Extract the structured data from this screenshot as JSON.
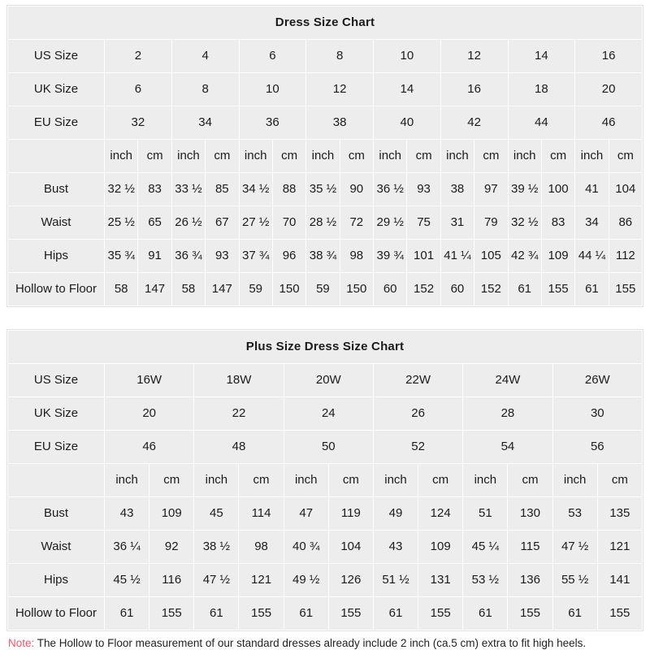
{
  "note": {
    "tag": "Note:",
    "text": " The Hollow to Floor measurement of our standard dresses already include 2 inch (ca.5 cm) extra to fit high heels."
  },
  "units": {
    "inch": "inch",
    "cm": "cm"
  },
  "labels": {
    "us_size": "US Size",
    "uk_size": "UK Size",
    "eu_size": "EU Size",
    "bust": "Bust",
    "waist": "Waist",
    "hips": "Hips",
    "hollow_to_floor": "Hollow to Floor"
  },
  "colors": {
    "cell_gray": "#ededed",
    "cell_white": "#ffffff",
    "grid_line": "#ffffff",
    "text": "#1b1b1b",
    "note_accent": "#f0566e"
  },
  "standard_chart": {
    "title": "Dress Size Chart",
    "size_count": 8,
    "us_sizes": [
      "2",
      "4",
      "6",
      "8",
      "10",
      "12",
      "14",
      "16"
    ],
    "uk_sizes": [
      "6",
      "8",
      "10",
      "12",
      "14",
      "16",
      "18",
      "20"
    ],
    "eu_sizes": [
      "32",
      "34",
      "36",
      "38",
      "40",
      "42",
      "44",
      "46"
    ],
    "measurements": [
      {
        "name": "Bust",
        "inch": [
          "32 ½",
          "33 ½",
          "34 ½",
          "35 ½",
          "36 ½",
          "38",
          "39 ½",
          "41"
        ],
        "cm": [
          "83",
          "85",
          "88",
          "90",
          "93",
          "97",
          "100",
          "104"
        ]
      },
      {
        "name": "Waist",
        "inch": [
          "25 ½",
          "26 ½",
          "27 ½",
          "28 ½",
          "29 ½",
          "31",
          "32 ½",
          "34"
        ],
        "cm": [
          "65",
          "67",
          "70",
          "72",
          "75",
          "79",
          "83",
          "86"
        ]
      },
      {
        "name": "Hips",
        "inch": [
          "35 ¾",
          "36 ¾",
          "37 ¾",
          "38 ¾",
          "39 ¾",
          "41 ¼",
          "42 ¾",
          "44 ¼"
        ],
        "cm": [
          "91",
          "93",
          "96",
          "98",
          "101",
          "105",
          "109",
          "112"
        ]
      },
      {
        "name": "Hollow to Floor",
        "inch": [
          "58",
          "58",
          "59",
          "59",
          "60",
          "60",
          "61",
          "61"
        ],
        "cm": [
          "147",
          "147",
          "150",
          "150",
          "152",
          "152",
          "155",
          "155"
        ]
      }
    ]
  },
  "plus_chart": {
    "title": "Plus Size Dress Size Chart",
    "size_count": 6,
    "us_sizes": [
      "16W",
      "18W",
      "20W",
      "22W",
      "24W",
      "26W"
    ],
    "uk_sizes": [
      "20",
      "22",
      "24",
      "26",
      "28",
      "30"
    ],
    "eu_sizes": [
      "46",
      "48",
      "50",
      "52",
      "54",
      "56"
    ],
    "measurements": [
      {
        "name": "Bust",
        "inch": [
          "43",
          "45",
          "47",
          "49",
          "51",
          "53"
        ],
        "cm": [
          "109",
          "114",
          "119",
          "124",
          "130",
          "135"
        ]
      },
      {
        "name": "Waist",
        "inch": [
          "36 ¼",
          "38 ½",
          "40 ¾",
          "43",
          "45 ¼",
          "47 ½"
        ],
        "cm": [
          "92",
          "98",
          "104",
          "109",
          "115",
          "121"
        ]
      },
      {
        "name": "Hips",
        "inch": [
          "45 ½",
          "47 ½",
          "49 ½",
          "51 ½",
          "53 ½",
          "55 ½"
        ],
        "cm": [
          "116",
          "121",
          "126",
          "131",
          "136",
          "141"
        ]
      },
      {
        "name": "Hollow to Floor",
        "inch": [
          "61",
          "61",
          "61",
          "61",
          "61",
          "61"
        ],
        "cm": [
          "155",
          "155",
          "155",
          "155",
          "155",
          "155"
        ]
      }
    ]
  }
}
